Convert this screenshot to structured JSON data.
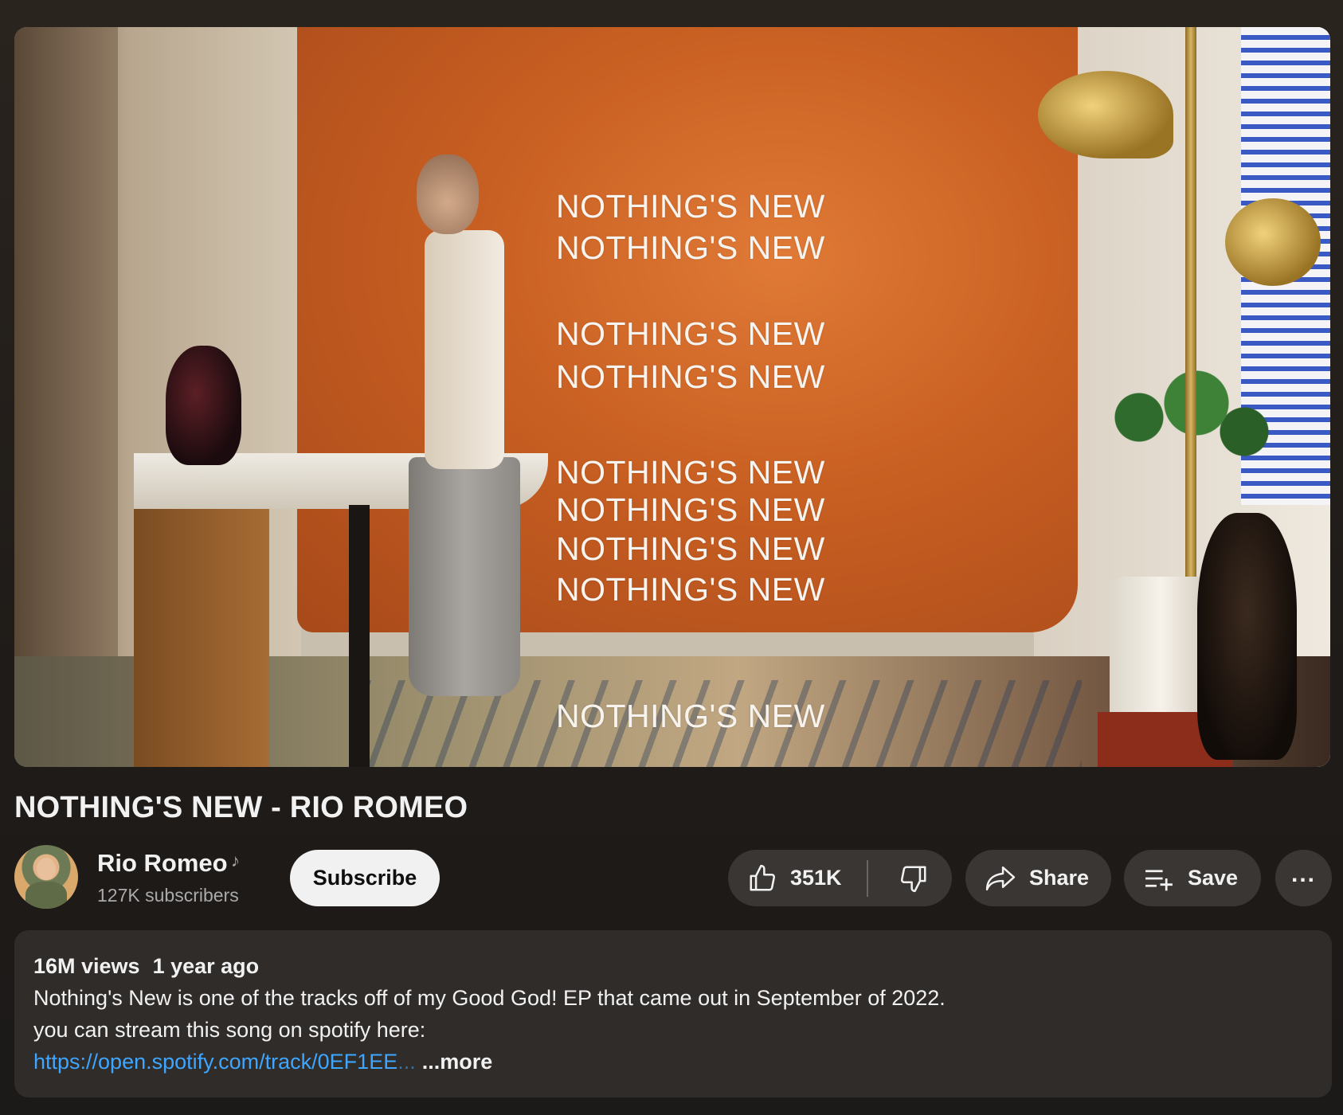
{
  "video": {
    "overlay_lyrics": [
      "NOTHING'S NEW",
      "NOTHING'S NEW",
      "NOTHING'S NEW",
      "NOTHING'S NEW",
      "NOTHING'S NEW",
      "NOTHING'S NEW",
      "NOTHING'S NEW",
      "NOTHING'S NEW",
      "NOTHING'S NEW"
    ],
    "title": "NOTHING'S NEW - RIO ROMEO"
  },
  "channel": {
    "name": "Rio Romeo",
    "subscribers": "127K subscribers",
    "verified_icon": "music-note-icon"
  },
  "actions": {
    "subscribe_label": "Subscribe",
    "like_count": "351K",
    "share_label": "Share",
    "save_label": "Save",
    "more_label": "..."
  },
  "description": {
    "views": "16M views",
    "age": "1 year ago",
    "line1": "Nothing's New is one of the tracks off of my Good God! EP that came out in September of 2022.",
    "line2": "you can stream this song on spotify here:",
    "link_text": "https://open.spotify.com/track/0EF1EE",
    "link_ellipsis": "...",
    "more_label": "...more"
  },
  "colors": {
    "link": "#3ea6ff",
    "pill_bg": "#3a3634",
    "subscribe_bg": "#f1f1f1"
  }
}
